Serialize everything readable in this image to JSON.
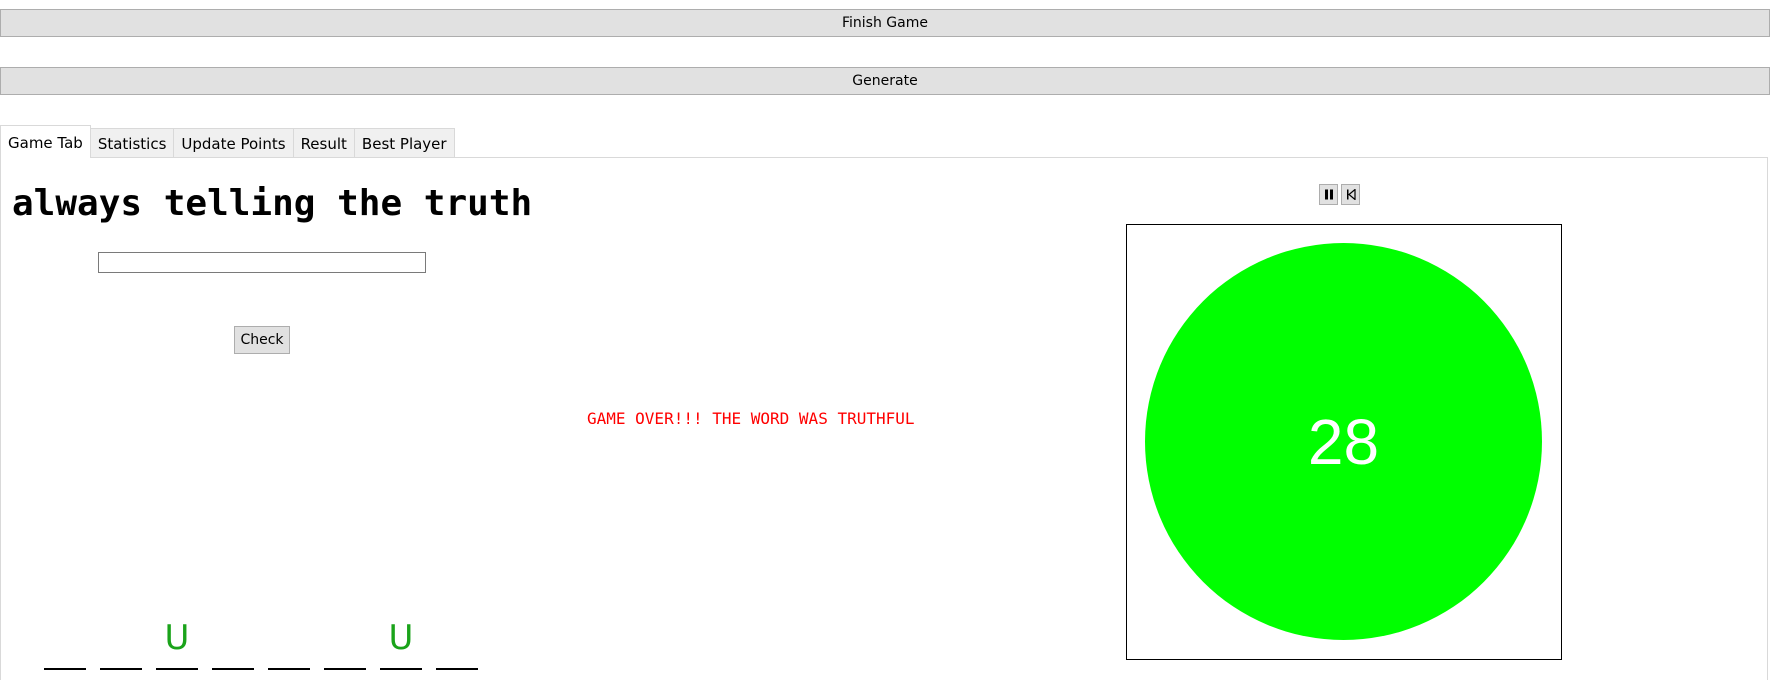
{
  "toolbar": {
    "finish_label": "Finish Game",
    "generate_label": "Generate"
  },
  "tabs": [
    {
      "label": "Game Tab",
      "active": true
    },
    {
      "label": "Statistics",
      "active": false
    },
    {
      "label": "Update Points",
      "active": false
    },
    {
      "label": "Result",
      "active": false
    },
    {
      "label": "Best Player",
      "active": false
    }
  ],
  "game": {
    "clue": "always telling the truth",
    "guess_value": "",
    "check_label": "Check",
    "status_message": "GAME OVER!!! THE WORD WAS TRUTHFUL",
    "status_color": "#ff0000",
    "word_slots": [
      "",
      "",
      "U",
      "",
      "",
      "",
      "U",
      ""
    ],
    "letter_color": "#1aa31a"
  },
  "timer": {
    "value": "28",
    "fill_color": "#00ff00",
    "controls": {
      "pause_icon": "pause-icon",
      "restart_icon": "skip-back-icon"
    }
  }
}
